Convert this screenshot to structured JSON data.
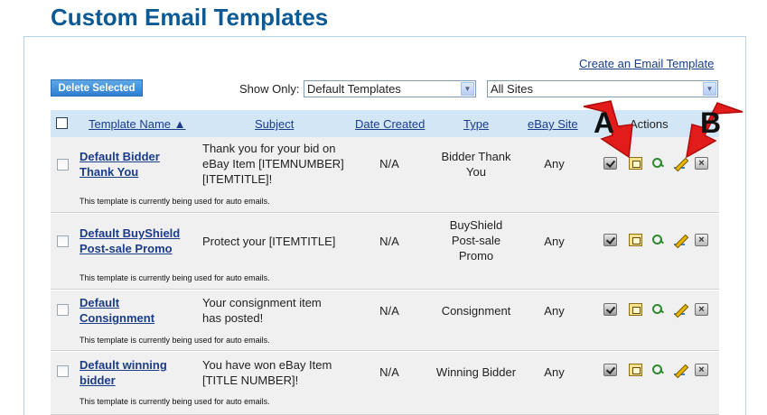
{
  "page": {
    "title": "Custom Email Templates"
  },
  "toolbar": {
    "create_link": "Create an Email Template",
    "delete_selected": "Delete Selected",
    "show_only_label": "Show Only:",
    "template_filter": "Default Templates",
    "site_filter": "All Sites"
  },
  "table": {
    "headers": {
      "name": "Template Name ▲",
      "subject": "Subject",
      "date": "Date Created",
      "type": "Type",
      "site": "eBay Site",
      "actions": "Actions"
    },
    "rows": [
      {
        "name": "Default Bidder Thank You",
        "subject": "Thank you for your bid on eBay Item [ITEMNUMBER] [ITEMTITLE]!",
        "date": "N/A",
        "type": "Bidder Thank You",
        "site": "Any",
        "note": "This template is currently being used for auto emails."
      },
      {
        "name": "Default BuyShield Post-sale Promo",
        "subject": "Protect your [ITEMTITLE]",
        "date": "N/A",
        "type": "BuyShield Post-sale Promo",
        "site": "Any",
        "note": "This template is currently being used for auto emails."
      },
      {
        "name": "Default Consignment",
        "subject": "Your consignment item has posted!",
        "date": "N/A",
        "type": "Consignment",
        "site": "Any",
        "note": "This template is currently being used for auto emails."
      },
      {
        "name": "Default winning bidder",
        "subject": "You have won eBay Item [TITLE NUMBER]!",
        "date": "N/A",
        "type": "Winning Bidder",
        "site": "Any",
        "note": "This template is currently being used for auto emails."
      }
    ]
  },
  "callouts": {
    "a": "A",
    "b": "B"
  },
  "colors": {
    "title": "#0b5a96",
    "header_bg": "#d3e6f5",
    "row_bg": "#f0f0f0",
    "callout_arrow": "#e21b1b"
  }
}
